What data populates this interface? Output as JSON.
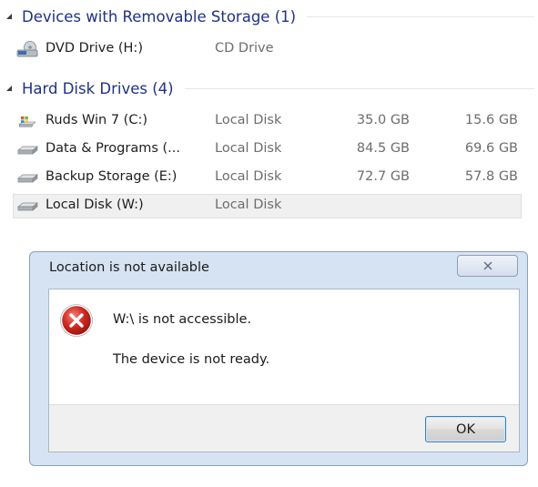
{
  "groups": [
    {
      "title": "Devices with Removable Storage (1)",
      "drives": [
        {
          "name": "DVD Drive (H:)",
          "type": "CD Drive",
          "total": "",
          "free": "",
          "icon": "dvd-drive-icon"
        }
      ]
    },
    {
      "title": "Hard Disk Drives (4)",
      "drives": [
        {
          "name": "Ruds Win 7 (C:)",
          "type": "Local Disk",
          "total": "35.0 GB",
          "free": "15.6 GB",
          "icon": "windows-drive-icon"
        },
        {
          "name": "Data & Programs (...",
          "type": "Local Disk",
          "total": "84.5 GB",
          "free": "69.6 GB",
          "icon": "hard-drive-icon"
        },
        {
          "name": "Backup Storage (E:)",
          "type": "Local Disk",
          "total": "72.7 GB",
          "free": "57.8 GB",
          "icon": "hard-drive-icon"
        },
        {
          "name": "Local Disk (W:)",
          "type": "Local Disk",
          "total": "",
          "free": "",
          "icon": "hard-drive-icon",
          "selected": true
        }
      ]
    }
  ],
  "dialog": {
    "title": "Location is not available",
    "message": "W:\\ is not accessible.",
    "detail": "The device is not ready.",
    "ok_label": "OK",
    "icon": "error-icon"
  },
  "colors": {
    "group_title": "#1e3287",
    "error_red": "#c8201e",
    "dialog_frame": "#d6e3f2"
  }
}
